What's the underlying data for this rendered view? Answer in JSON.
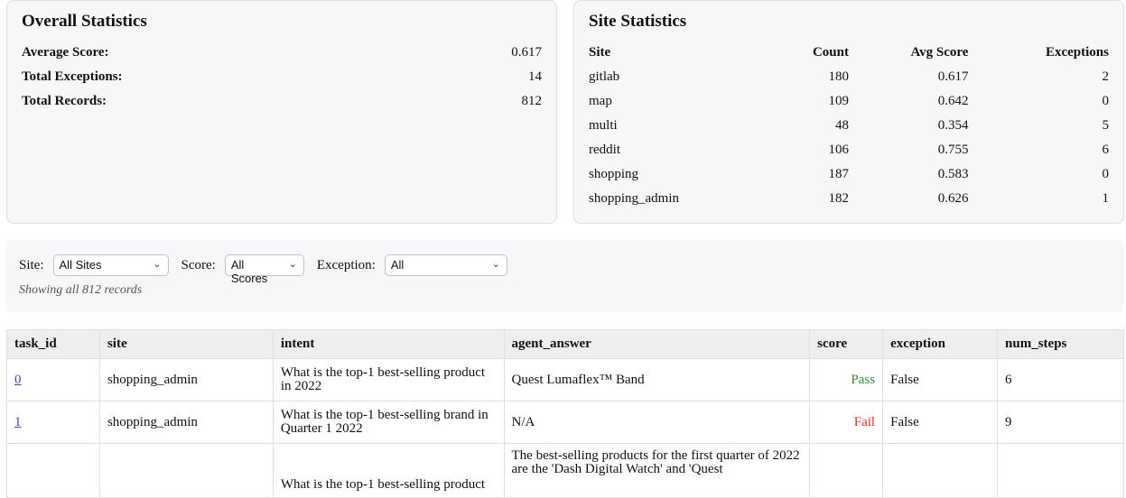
{
  "overall": {
    "title": "Overall Statistics",
    "rows": [
      {
        "label": "Average Score:",
        "value": "0.617"
      },
      {
        "label": "Total Exceptions:",
        "value": "14"
      },
      {
        "label": "Total Records:",
        "value": "812"
      }
    ]
  },
  "site_stats": {
    "title": "Site Statistics",
    "headers": [
      "Site",
      "Count",
      "Avg Score",
      "Exceptions"
    ],
    "rows": [
      [
        "gitlab",
        "180",
        "0.617",
        "2"
      ],
      [
        "map",
        "109",
        "0.642",
        "0"
      ],
      [
        "multi",
        "48",
        "0.354",
        "5"
      ],
      [
        "reddit",
        "106",
        "0.755",
        "6"
      ],
      [
        "shopping",
        "187",
        "0.583",
        "0"
      ],
      [
        "shopping_admin",
        "182",
        "0.626",
        "1"
      ]
    ]
  },
  "filters": {
    "site_label": "Site:",
    "site_value": "All Sites",
    "score_label": "Score:",
    "score_value": "All Scores",
    "exception_label": "Exception:",
    "exception_value": "All",
    "showing": "Showing all 812 records"
  },
  "records": {
    "headers": [
      "task_id",
      "site",
      "intent",
      "agent_answer",
      "score",
      "exception",
      "num_steps"
    ],
    "rows": [
      {
        "task_id": "0",
        "site": "shopping_admin",
        "intent": "What is the top-1 best-selling product in 2022",
        "agent_answer": "Quest Lumaflex™ Band",
        "score": "Pass",
        "exception": "False",
        "num_steps": "6"
      },
      {
        "task_id": "1",
        "site": "shopping_admin",
        "intent": "What is the top-1 best-selling brand in Quarter 1 2022",
        "agent_answer": "N/A",
        "score": "Fail",
        "exception": "False",
        "num_steps": "9"
      },
      {
        "task_id": "",
        "site": "",
        "intent": "What is the top-1 best-selling product",
        "agent_answer": "The best-selling products for the first quarter of 2022 are the 'Dash Digital Watch' and 'Quest",
        "score": "",
        "exception": "",
        "num_steps": ""
      }
    ]
  },
  "colors": {
    "pass": "#2d8a2d",
    "fail": "#d8342a",
    "link": "#5a3ea8",
    "card_bg": "#f6f7f8"
  }
}
